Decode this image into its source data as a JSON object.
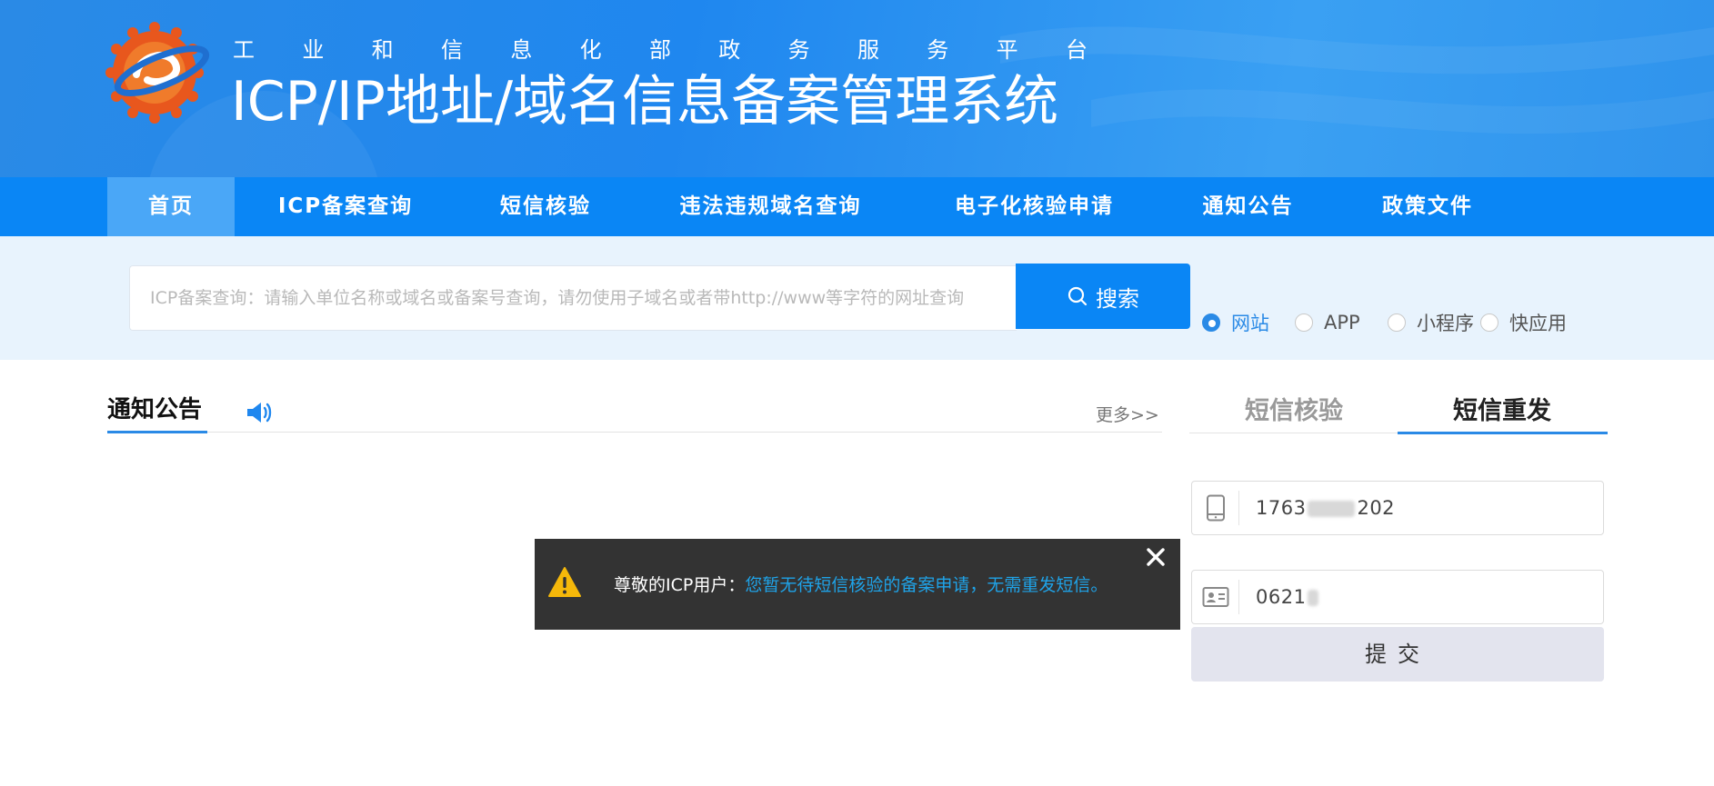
{
  "banner": {
    "subtitle_chars": [
      "工",
      "业",
      "和",
      "信",
      "息",
      "化",
      "部",
      "政",
      "务",
      "服",
      "务",
      "平",
      "台"
    ],
    "title": "ICP/IP地址/域名信息备案管理系统"
  },
  "nav": {
    "items": [
      {
        "label": "首页"
      },
      {
        "label": "ICP备案查询"
      },
      {
        "label": "短信核验"
      },
      {
        "label": "违法违规域名查询"
      },
      {
        "label": "电子化核验申请"
      },
      {
        "label": "通知公告"
      },
      {
        "label": "政策文件"
      }
    ],
    "active_index": 0
  },
  "search": {
    "placeholder": "ICP备案查询：请输入单位名称或域名或备案号查询，请勿使用子域名或者带http://www等字符的网址查询",
    "value": "",
    "button_label": "搜索",
    "options": [
      {
        "label": "网站",
        "checked": true
      },
      {
        "label": "APP",
        "checked": false
      },
      {
        "label": "小程序",
        "checked": false
      },
      {
        "label": "快应用",
        "checked": false
      }
    ]
  },
  "notice": {
    "tab_label": "通知公告",
    "more_label": "更多>>"
  },
  "sms_panel": {
    "tabs": [
      {
        "label": "短信核验",
        "active": false
      },
      {
        "label": "短信重发",
        "active": true
      }
    ],
    "phone": {
      "prefix": "1763",
      "suffix": "202"
    },
    "id_code": {
      "prefix": "0621"
    },
    "submit_label": "提交"
  },
  "toast": {
    "prefix": "尊敬的ICP用户：",
    "message": "您暂无待短信核验的备案申请，无需重发短信。"
  },
  "colors": {
    "brand_blue": "#0a86f5",
    "nav_active": "#4aa7f7",
    "search_band": "#e8f3fd",
    "toast_bg": "#333333",
    "toast_msg": "#1fa3e8"
  }
}
